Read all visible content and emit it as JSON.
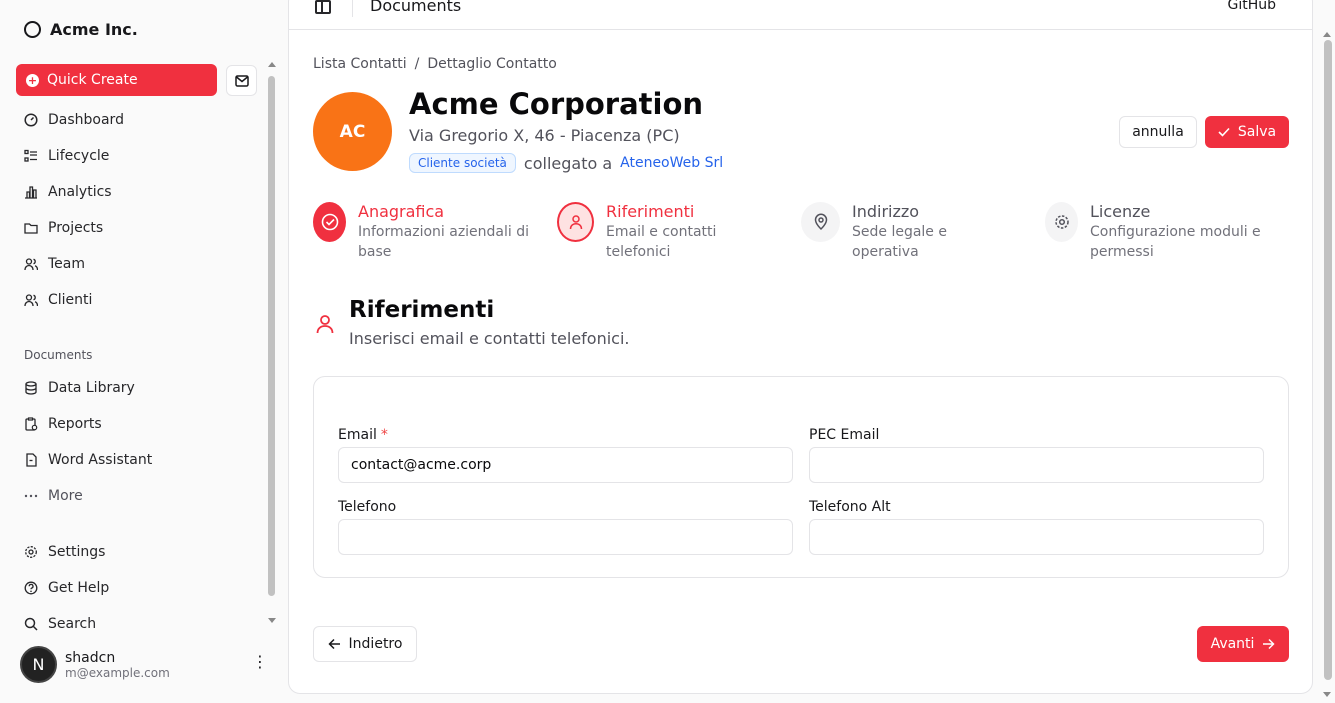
{
  "sidebar": {
    "brand": "Acme Inc.",
    "quick_create": "Quick Create",
    "nav": [
      {
        "label": "Dashboard",
        "icon": "dashboard-icon"
      },
      {
        "label": "Lifecycle",
        "icon": "list-icon"
      },
      {
        "label": "Analytics",
        "icon": "bar-chart-icon"
      },
      {
        "label": "Projects",
        "icon": "folder-icon"
      },
      {
        "label": "Team",
        "icon": "users-icon"
      },
      {
        "label": "Clienti",
        "icon": "users-icon"
      }
    ],
    "documents_label": "Documents",
    "documents": [
      {
        "label": "Data Library",
        "icon": "database-icon"
      },
      {
        "label": "Reports",
        "icon": "clipboard-icon"
      },
      {
        "label": "Word Assistant",
        "icon": "file-icon"
      },
      {
        "label": "More",
        "icon": "more-icon"
      }
    ],
    "secondary": [
      {
        "label": "Settings",
        "icon": "gear-icon"
      },
      {
        "label": "Get Help",
        "icon": "help-icon"
      },
      {
        "label": "Search",
        "icon": "search-icon"
      }
    ],
    "user": {
      "initial": "N",
      "name": "shadcn",
      "email": "m@example.com"
    }
  },
  "topbar": {
    "title": "Documents",
    "github": "GitHub"
  },
  "breadcrumb": [
    "Lista Contatti",
    "/",
    "Dettaglio Contatto"
  ],
  "header": {
    "initials": "AC",
    "name": "Acme Corporation",
    "address": "Via Gregorio X, 46 - Piacenza (PC)",
    "badge": "Cliente società",
    "linked_text": "collegato a",
    "linked_company": "AteneoWeb Srl",
    "cancel": "annulla",
    "save": "Salva"
  },
  "steps": [
    {
      "title": "Anagrafica",
      "desc": "Informazioni aziendali di base",
      "state": "done"
    },
    {
      "title": "Riferimenti",
      "desc": "Email e contatti telefonici",
      "state": "active"
    },
    {
      "title": "Indirizzo",
      "desc": "Sede legale e operativa",
      "state": "pending"
    },
    {
      "title": "Licenze",
      "desc": "Configurazione moduli e permessi",
      "state": "pending"
    }
  ],
  "section": {
    "title": "Riferimenti",
    "subtitle": "Inserisci email e contatti telefonici."
  },
  "form": {
    "email": {
      "label": "Email",
      "required": "*",
      "value": "contact@acme.corp"
    },
    "pec": {
      "label": "PEC Email",
      "value": ""
    },
    "phone": {
      "label": "Telefono",
      "value": ""
    },
    "phone_alt": {
      "label": "Telefono Alt",
      "value": ""
    }
  },
  "footer": {
    "back": "Indietro",
    "next": "Avanti"
  },
  "colors": {
    "accent": "#f0303f",
    "avatar": "#f97316",
    "link": "#2563eb"
  }
}
